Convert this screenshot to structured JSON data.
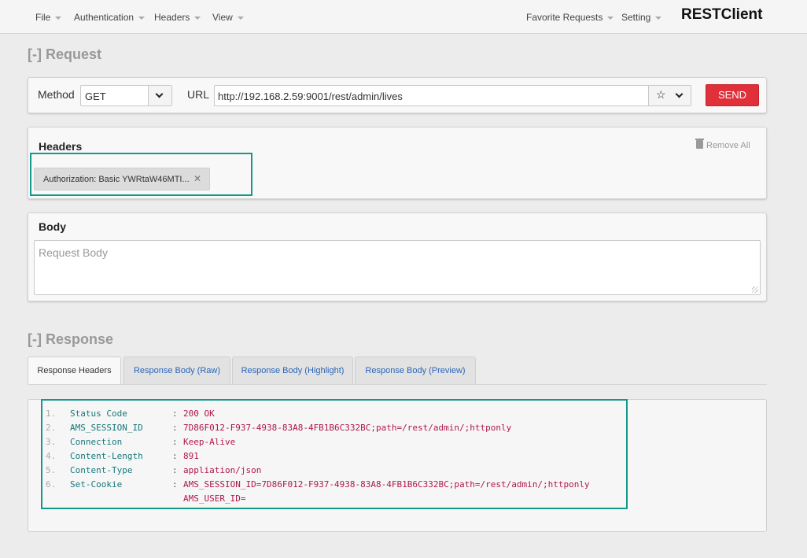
{
  "nav": {
    "menus": [
      "File",
      "Authentication",
      "Headers",
      "View"
    ],
    "right_menus": [
      "Favorite Requests",
      "Setting"
    ],
    "brand": "RESTClient"
  },
  "request": {
    "section_title": "[-] Request",
    "method_label": "Method",
    "method_value": "GET",
    "url_label": "URL",
    "url_value": "http://192.168.2.59:9001/rest/admin/lives",
    "send_label": "SEND"
  },
  "headers": {
    "title": "Headers",
    "remove_all": "Remove All",
    "items": [
      "Authorization: Basic YWRtaW46MTI..."
    ]
  },
  "body": {
    "title": "Body",
    "placeholder": "Request Body"
  },
  "response": {
    "section_title": "[-] Response",
    "tabs": [
      "Response Headers",
      "Response Body (Raw)",
      "Response Body (Highlight)",
      "Response Body (Preview)"
    ],
    "active_tab": "Response Headers",
    "lines": [
      {
        "num": "1.",
        "key": "Status Code",
        "value": "200 OK"
      },
      {
        "num": "2.",
        "key": "AMS_SESSION_ID",
        "value": "7D86F012-F937-4938-83A8-4FB1B6C332BC;path=/rest/admin/;httponly"
      },
      {
        "num": "3.",
        "key": "Connection",
        "value": "Keep-Alive"
      },
      {
        "num": "4.",
        "key": "Content-Length",
        "value": "891"
      },
      {
        "num": "5.",
        "key": "Content-Type",
        "value": "appliation/json"
      },
      {
        "num": "6.",
        "key": "Set-Cookie",
        "value": "AMS_SESSION_ID=7D86F012-F937-4938-83A8-4FB1B6C332BC;path=/rest/admin/;httponly"
      }
    ],
    "continuation": "AMS_USER_ID="
  },
  "colors": {
    "send": "#e0303a",
    "highlight_box": "#13998c",
    "header_key": "#16787a",
    "header_value": "#b0174a",
    "tab_link": "#2a66b8"
  }
}
